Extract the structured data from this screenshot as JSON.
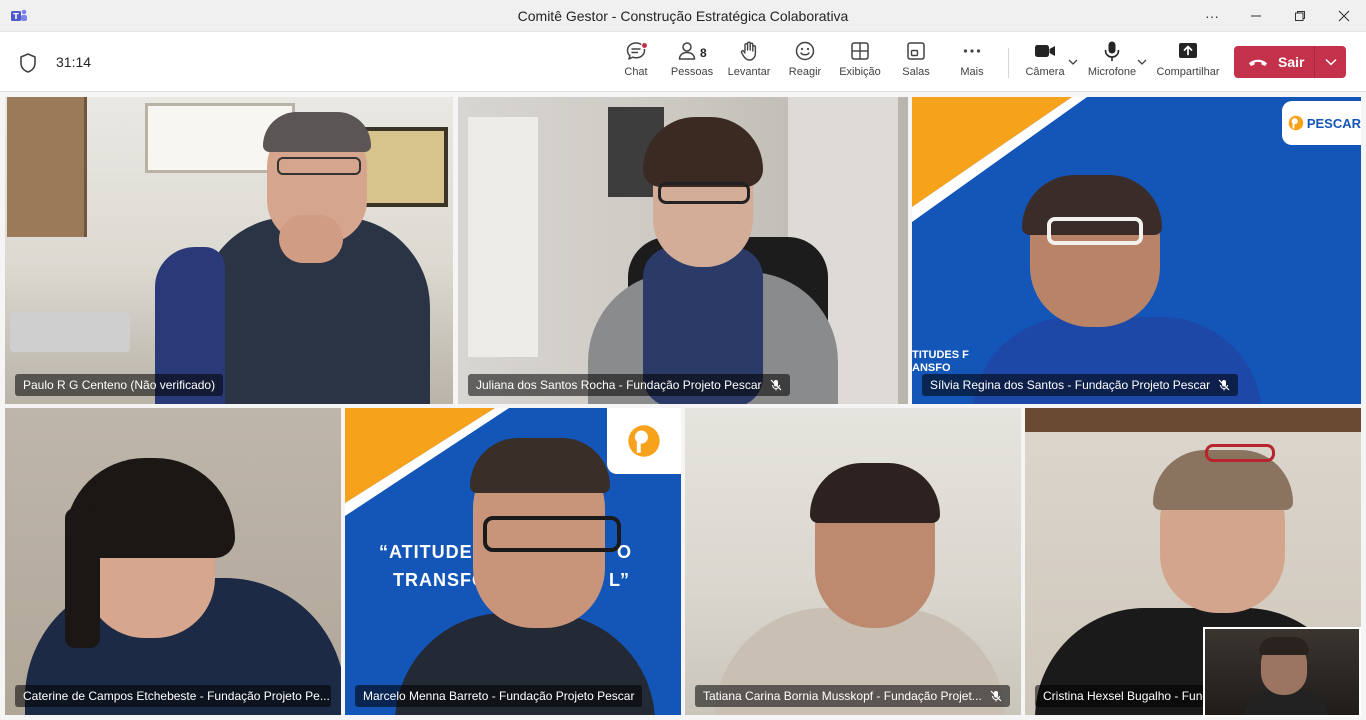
{
  "window": {
    "title": "Comitê Gestor - Construção Estratégica Colaborativa",
    "more_label": "···"
  },
  "meeting": {
    "timer": "31:14"
  },
  "toolbar": {
    "chat_label": "Chat",
    "people_label": "Pessoas",
    "people_count": "8",
    "raise_label": "Levantar",
    "react_label": "Reagir",
    "view_label": "Exibição",
    "rooms_label": "Salas",
    "more_label": "Mais",
    "camera_label": "Câmera",
    "mic_label": "Microfone",
    "share_label": "Compartilhar",
    "leave_label": "Sair"
  },
  "participants": [
    {
      "name": "Paulo R G Centeno (Não verificado)",
      "muted": false,
      "speaking": true
    },
    {
      "name": "Juliana dos Santos Rocha - Fundação Projeto Pescar",
      "muted": true,
      "speaking": false
    },
    {
      "name": "Sílvia Regina dos Santos - Fundação Projeto Pescar",
      "muted": true,
      "speaking": false
    },
    {
      "name": "Caterine de Campos Etchebeste - Fundação Projeto Pe...",
      "muted": false,
      "speaking": true
    },
    {
      "name": "Marcelo Menna Barreto - Fundação Projeto Pescar",
      "muted": false,
      "speaking": false
    },
    {
      "name": "Tatiana Carina Bornia Musskopf - Fundação Projet...",
      "muted": true,
      "speaking": false
    },
    {
      "name": "Cristina Hexsel Bugalho - Fundação Projeto Pescar",
      "muted": true,
      "speaking": false
    }
  ],
  "backgrounds": {
    "pescar_brand": "PESCAR",
    "pescar_slogan_line1": "“ATITUDE",
    "pescar_slogan_line1_end": "O",
    "pescar_slogan_line2": "TRANSFO",
    "pescar_slogan_line2_end": "L”",
    "silvia_banner_line1": "TITUDES F",
    "silvia_banner_line2": "ANSFO"
  },
  "colors": {
    "accent": "#6264a7",
    "leave": "#c4314b",
    "pescar_blue": "#1456b8",
    "pescar_orange": "#f7a21b"
  }
}
